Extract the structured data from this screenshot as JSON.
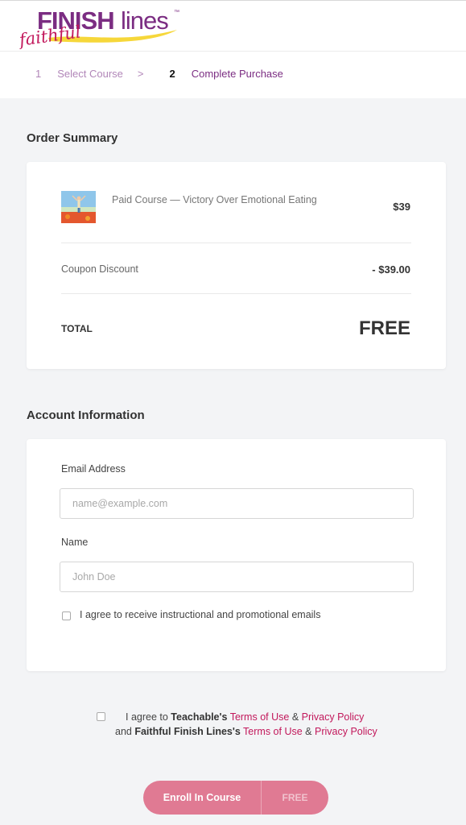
{
  "brand": {
    "logo_main": "FINISH",
    "logo_secondary": "lines",
    "logo_script": "faithful",
    "logo_tm": "™",
    "purple": "#7b2d82",
    "pink": "#c2185b",
    "yellow": "#f6d73a"
  },
  "steps": [
    {
      "number": "1",
      "label": "Select Course"
    },
    {
      "number": "2",
      "label": "Complete Purchase"
    }
  ],
  "step_separator": ">",
  "order_summary": {
    "title": "Order Summary",
    "course_title": "Paid Course — Victory Over Emotional Eating",
    "course_price": "$39",
    "coupon_label": "Coupon Discount",
    "coupon_value": "- $39.00",
    "total_label": "TOTAL",
    "total_value": "FREE"
  },
  "account": {
    "title": "Account Information",
    "email_label": "Email Address",
    "email_placeholder": "name@example.com",
    "name_label": "Name",
    "name_placeholder": "John Doe",
    "promo_checkbox_label": "I agree to receive instructional and promotional emails"
  },
  "terms": {
    "prefix": "I agree to ",
    "company_1": "Teachable's",
    "terms_link": "Terms of Use",
    "amp": "&",
    "privacy_link": "Privacy Policy",
    "and": "and",
    "company_2": "Faithful Finish Lines's"
  },
  "enroll": {
    "label": "Enroll In Course",
    "price": "FREE",
    "color": "#e07a93"
  }
}
